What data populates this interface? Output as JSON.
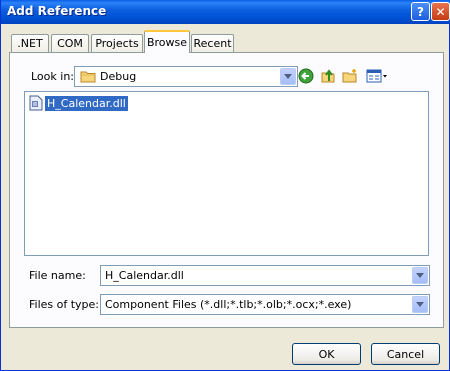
{
  "window": {
    "title": "Add Reference",
    "help_glyph": "?",
    "close_glyph": "✕"
  },
  "tabs": [
    {
      "label": ".NET"
    },
    {
      "label": "COM"
    },
    {
      "label": "Projects"
    },
    {
      "label": "Browse"
    },
    {
      "label": "Recent"
    }
  ],
  "active_tab": "Browse",
  "look_in": {
    "label": "Look in:",
    "value": "Debug"
  },
  "toolbar": {
    "icons": [
      "back-icon",
      "up-folder-icon",
      "new-folder-icon",
      "view-menu-icon"
    ]
  },
  "files": [
    {
      "name": "H_Calendar.dll",
      "icon": "dll-file-icon",
      "selected": true
    }
  ],
  "file_name": {
    "label": "File name:",
    "value": "H_Calendar.dll"
  },
  "file_type": {
    "label": "Files of type:",
    "value": "Component Files (*.dll;*.tlb;*.olb;*.ocx;*.exe)"
  },
  "buttons": {
    "ok": "OK",
    "cancel": "Cancel"
  },
  "colors": {
    "titlebar": "#0054e3",
    "selection": "#316ac5",
    "dialog_bg": "#ece9d8",
    "active_tab_accent": "#ffc83c"
  }
}
